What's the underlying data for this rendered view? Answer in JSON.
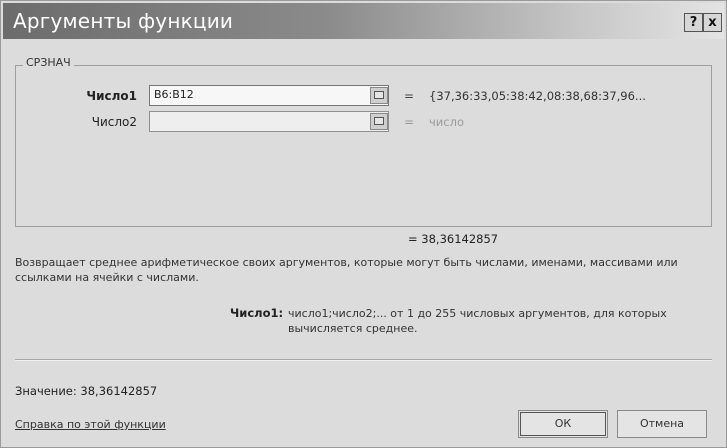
{
  "dialog": {
    "title": "Аргументы функции",
    "help_button": "?",
    "close_button": "x",
    "function_group": "СРЗНАЧ"
  },
  "arguments": [
    {
      "label": "Число1",
      "value": "B6:B12",
      "evaluated": "{37,36:33,05:38:42,08:38,68:37,96..."
    },
    {
      "label": "Число2",
      "value": "",
      "evaluated": "число"
    }
  ],
  "result": {
    "equals": "=",
    "value": "38,36142857"
  },
  "description": "Возвращает среднее арифметическое своих аргументов, которые могут быть числами, именами, массивами или ссылками на ячейки с числами.",
  "argument_help": {
    "label": "Число1:",
    "text": "число1;число2;... от 1 до 255 числовых аргументов, для которых вычисляется среднее."
  },
  "value_line": "Значение:  38,36142857",
  "help_link": "Справка по этой функции",
  "buttons": {
    "ok": "ОК",
    "cancel": "Отмена"
  }
}
